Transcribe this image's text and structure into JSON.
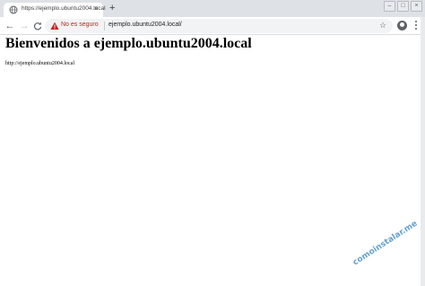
{
  "browser": {
    "tab": {
      "title": "https://ejemplo.ubuntu2004.local",
      "close_glyph": "×",
      "favicon": "globe-icon"
    },
    "new_tab_glyph": "+",
    "window_controls": {
      "minimize": "–",
      "maximize": "□",
      "close": "×"
    },
    "toolbar": {
      "back_glyph": "←",
      "forward_glyph": "→",
      "reload_glyph": "C",
      "security_text": "No es seguro",
      "security_color": "#c5221f",
      "url": "ejemplo.ubuntu2004.local/",
      "bookmark_glyph": "☆"
    }
  },
  "page": {
    "heading": "Bienvenidos a ejemplo.ubuntu2004.local",
    "url_text": "http://ejemplo.ubuntu2004.local"
  },
  "watermark": "comoinstalar.me"
}
